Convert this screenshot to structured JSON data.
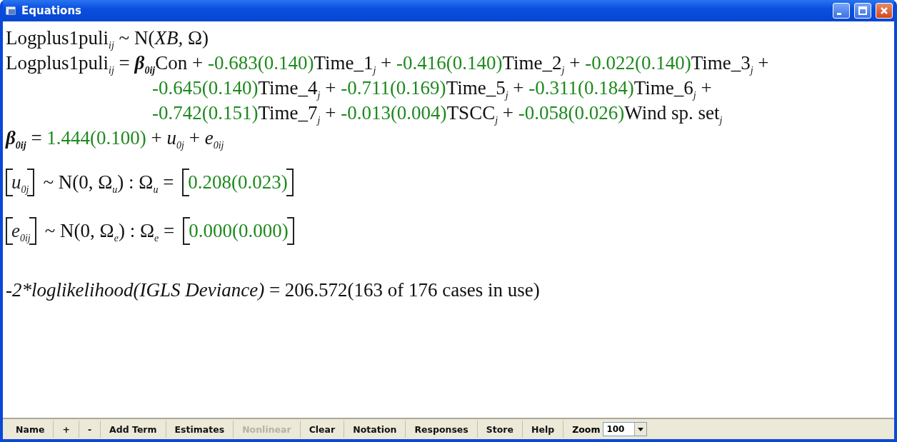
{
  "window": {
    "title": "Equations"
  },
  "equations": [
    {
      "kind": "line",
      "parts": [
        {
          "kind": "text",
          "text": "Logplus1puli$_{ij}$ ~ N("
        },
        {
          "kind": "italic",
          "text": "XB,"
        },
        {
          "kind": "text",
          "text": " Ω)"
        }
      ]
    },
    {
      "kind": "line",
      "parts": [
        {
          "kind": "text",
          "text": "Logplus1puli$_{ij}$ = "
        },
        {
          "kind": "symbol",
          "text": "β$_{0ij}$"
        },
        {
          "kind": "text",
          "text": "Con + "
        },
        {
          "kind": "estimate",
          "text": "-0.683(0.140)"
        },
        {
          "kind": "text",
          "text": "Time_1$_{j}$ + "
        },
        {
          "kind": "estimate",
          "text": "-0.416(0.140)"
        },
        {
          "kind": "text",
          "text": "Time_2$_{j}$ + "
        },
        {
          "kind": "estimate",
          "text": "-0.022(0.140)"
        },
        {
          "kind": "text",
          "text": "Time_3$_{j}$ +"
        }
      ]
    },
    {
      "kind": "continuation",
      "parts": [
        {
          "kind": "estimate",
          "text": "-0.645(0.140)"
        },
        {
          "kind": "text",
          "text": "Time_4$_{j}$ + "
        },
        {
          "kind": "estimate",
          "text": "-0.711(0.169)"
        },
        {
          "kind": "text",
          "text": "Time_5$_{j}$ + "
        },
        {
          "kind": "estimate",
          "text": "-0.311(0.184)"
        },
        {
          "kind": "text",
          "text": "Time_6$_{j}$ +"
        }
      ]
    },
    {
      "kind": "continuation",
      "parts": [
        {
          "kind": "estimate",
          "text": "-0.742(0.151)"
        },
        {
          "kind": "text",
          "text": "Time_7$_{j}$ + "
        },
        {
          "kind": "estimate",
          "text": "-0.013(0.004)"
        },
        {
          "kind": "text",
          "text": "TSCC$_{j}$ + "
        },
        {
          "kind": "estimate",
          "text": "-0.058(0.026)"
        },
        {
          "kind": "text",
          "text": "Wind sp. set$_{j}$"
        }
      ]
    },
    {
      "kind": "line",
      "parts": [
        {
          "kind": "symbol",
          "text": "β$_{0ij}$"
        },
        {
          "kind": "text",
          "text": " = "
        },
        {
          "kind": "estimate",
          "text": "1.444(0.100)"
        },
        {
          "kind": "text",
          "text": " + *u*$_{0j}$ + *e*$_{0ij}$"
        }
      ]
    },
    {
      "kind": "matrix",
      "vector": "*u*$_{0j}$",
      "distribution": "~ N(0,  Ω$_{u}$)  :  Ω$_{u}$ =",
      "estimate": "0.208(0.023)"
    },
    {
      "kind": "matrix",
      "vector": "*e*$_{0ij}$",
      "distribution": "~ N(0,  Ω$_{e}$)  :  Ω$_{e}$ =",
      "estimate": "0.000(0.000)"
    },
    {
      "kind": "deviance",
      "parts": [
        {
          "kind": "italic",
          "text": "-2*loglikelihood(IGLS Deviance)"
        },
        {
          "kind": "text",
          "text": " = 206.572(163 of 176 cases in use)"
        }
      ]
    }
  ],
  "toolbar": {
    "buttons": [
      {
        "label": "Name",
        "disabled": false
      },
      {
        "label": "+",
        "disabled": false
      },
      {
        "label": "-",
        "disabled": false
      },
      {
        "label": "Add Term",
        "disabled": false
      },
      {
        "label": "Estimates",
        "disabled": false
      },
      {
        "label": "Nonlinear",
        "disabled": true
      },
      {
        "label": "Clear",
        "disabled": false
      },
      {
        "label": "Notation",
        "disabled": false
      },
      {
        "label": "Responses",
        "disabled": false
      },
      {
        "label": "Store",
        "disabled": false
      },
      {
        "label": "Help",
        "disabled": false
      }
    ],
    "zoom": {
      "label": "Zoom",
      "value": "100"
    }
  }
}
